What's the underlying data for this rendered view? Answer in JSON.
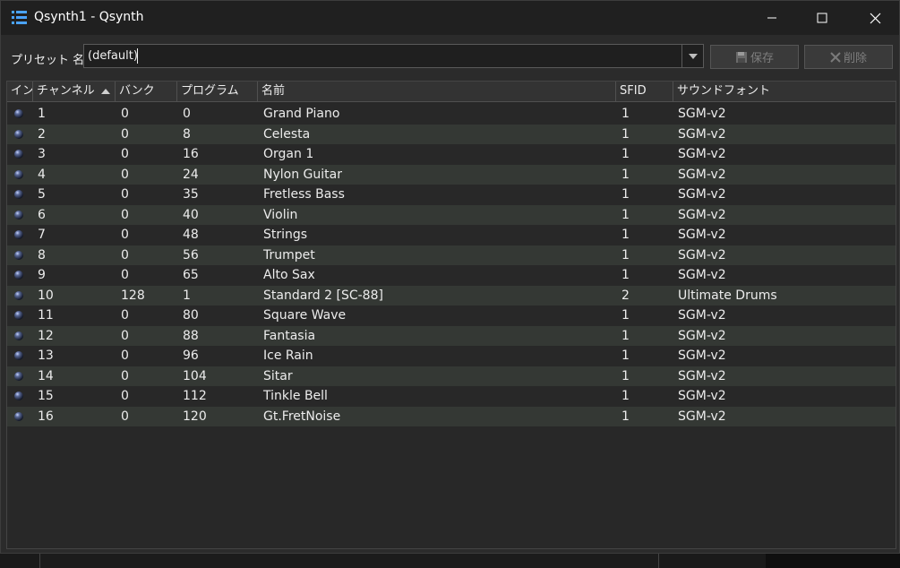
{
  "window": {
    "title": "Qsynth1 - Qsynth",
    "app_icon": "list-icon",
    "controls": [
      "minimize-icon",
      "maximize-icon",
      "close-icon"
    ]
  },
  "toolbar": {
    "preset_label": "プリセット 名:",
    "preset_value": "(default)",
    "save_label": "保存",
    "delete_label": "削除"
  },
  "table": {
    "columns": [
      "イン",
      "チャンネル",
      "バンク",
      "プログラム",
      "名前",
      "SFID",
      "サウンドフォント"
    ],
    "sort_column": "チャンネル",
    "rows": [
      {
        "ch": "1",
        "bank": "0",
        "prog": "0",
        "name": "Grand Piano",
        "sfid": "1",
        "sf": "SGM-v2"
      },
      {
        "ch": "2",
        "bank": "0",
        "prog": "8",
        "name": "Celesta",
        "sfid": "1",
        "sf": "SGM-v2"
      },
      {
        "ch": "3",
        "bank": "0",
        "prog": "16",
        "name": "Organ 1",
        "sfid": "1",
        "sf": "SGM-v2"
      },
      {
        "ch": "4",
        "bank": "0",
        "prog": "24",
        "name": "Nylon Guitar",
        "sfid": "1",
        "sf": "SGM-v2"
      },
      {
        "ch": "5",
        "bank": "0",
        "prog": "35",
        "name": "Fretless Bass",
        "sfid": "1",
        "sf": "SGM-v2"
      },
      {
        "ch": "6",
        "bank": "0",
        "prog": "40",
        "name": "Violin",
        "sfid": "1",
        "sf": "SGM-v2"
      },
      {
        "ch": "7",
        "bank": "0",
        "prog": "48",
        "name": "Strings",
        "sfid": "1",
        "sf": "SGM-v2"
      },
      {
        "ch": "8",
        "bank": "0",
        "prog": "56",
        "name": "Trumpet",
        "sfid": "1",
        "sf": "SGM-v2"
      },
      {
        "ch": "9",
        "bank": "0",
        "prog": "65",
        "name": "Alto Sax",
        "sfid": "1",
        "sf": "SGM-v2"
      },
      {
        "ch": "10",
        "bank": "128",
        "prog": "1",
        "name": "Standard 2 [SC-88]",
        "sfid": "2",
        "sf": "Ultimate Drums"
      },
      {
        "ch": "11",
        "bank": "0",
        "prog": "80",
        "name": "Square Wave",
        "sfid": "1",
        "sf": "SGM-v2"
      },
      {
        "ch": "12",
        "bank": "0",
        "prog": "88",
        "name": "Fantasia",
        "sfid": "1",
        "sf": "SGM-v2"
      },
      {
        "ch": "13",
        "bank": "0",
        "prog": "96",
        "name": "Ice Rain",
        "sfid": "1",
        "sf": "SGM-v2"
      },
      {
        "ch": "14",
        "bank": "0",
        "prog": "104",
        "name": "Sitar",
        "sfid": "1",
        "sf": "SGM-v2"
      },
      {
        "ch": "15",
        "bank": "0",
        "prog": "112",
        "name": "Tinkle Bell",
        "sfid": "1",
        "sf": "SGM-v2"
      },
      {
        "ch": "16",
        "bank": "0",
        "prog": "120",
        "name": "Gt.FretNoise",
        "sfid": "1",
        "sf": "SGM-v2"
      }
    ]
  },
  "colors": {
    "window_bg": "#2b2b2b",
    "titlebar_bg": "#202020",
    "row_alt": "#343834",
    "led": "#5a6a99"
  }
}
